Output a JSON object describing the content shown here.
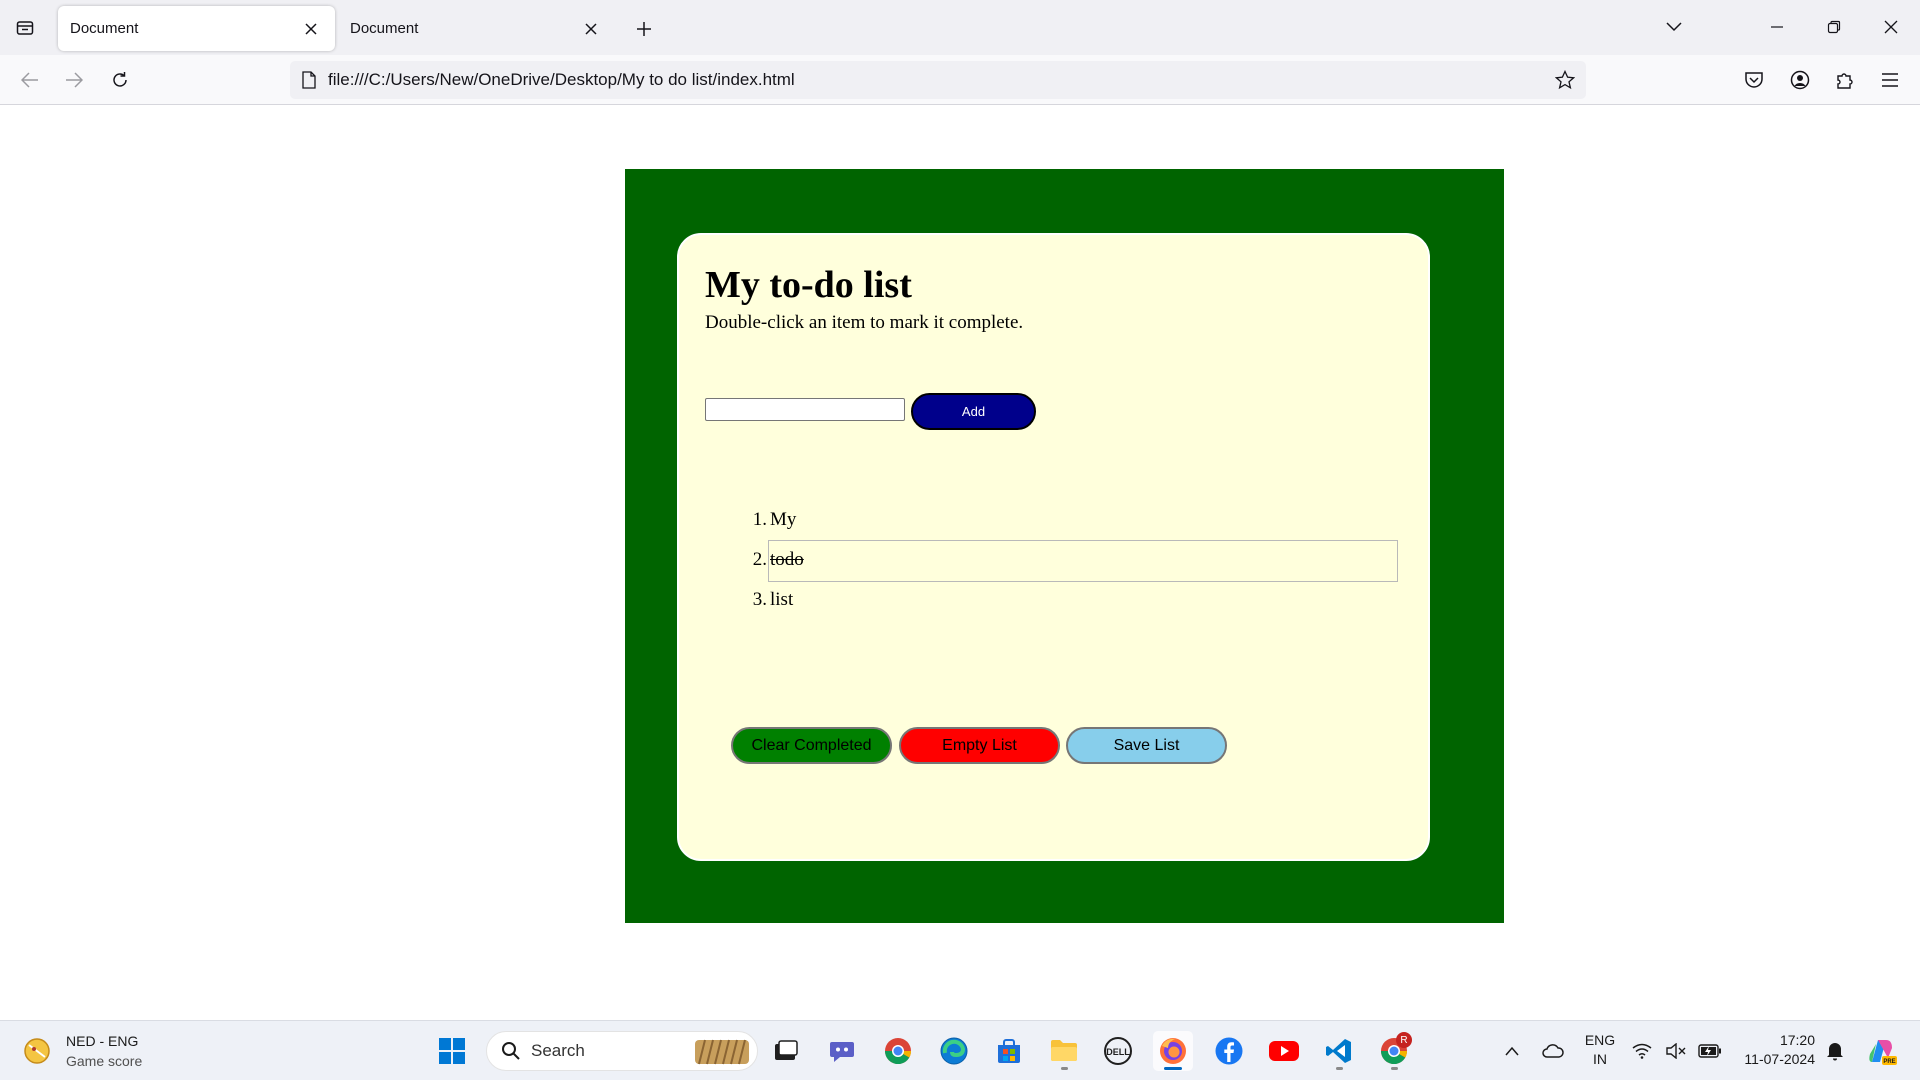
{
  "browser": {
    "tabs": [
      {
        "title": "Document",
        "active": true
      },
      {
        "title": "Document",
        "active": false
      }
    ],
    "url": "file:///C:/Users/New/OneDrive/Desktop/My to do list/index.html"
  },
  "page": {
    "title": "My to-do list",
    "subtitle": "Double-click an item to mark it complete.",
    "input_value": "",
    "add_label": "Add",
    "items": [
      {
        "number": "1.",
        "text": "My",
        "completed": false
      },
      {
        "number": "2.",
        "text": "todo",
        "completed": true
      },
      {
        "number": "3.",
        "text": "list",
        "completed": false
      }
    ],
    "buttons": {
      "clear_completed": "Clear Completed",
      "empty_list": "Empty List",
      "save_list": "Save List"
    },
    "colors": {
      "outer_background": "#006400",
      "card_background": "#ffffdc",
      "add_button": "#00008b",
      "clear_button": "#008000",
      "empty_button": "#ff0000",
      "save_button": "#87ceeb"
    }
  },
  "taskbar": {
    "weather": {
      "title": "NED - ENG",
      "subtitle": "Game score"
    },
    "search_label": "Search",
    "language": {
      "line1": "ENG",
      "line2": "IN"
    },
    "clock": {
      "time": "17:20",
      "date": "11-07-2024"
    },
    "chrome_badge": "R",
    "pinned_apps": [
      "windows-start",
      "search",
      "widgets",
      "task-view",
      "teams",
      "chrome",
      "edge",
      "microsoft-store",
      "file-explorer",
      "dell",
      "firefox",
      "facebook",
      "youtube",
      "vscode",
      "chrome-profile"
    ]
  }
}
